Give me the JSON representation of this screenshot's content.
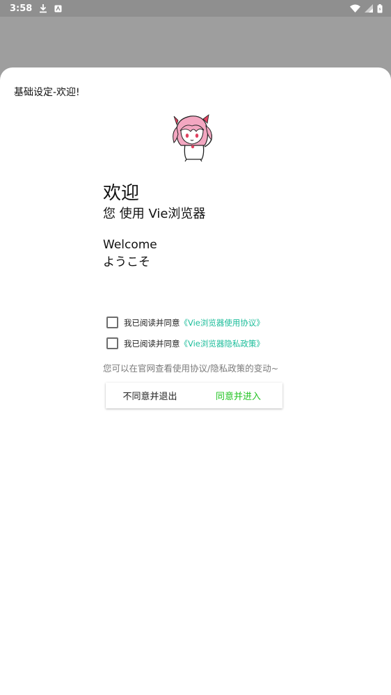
{
  "status_bar": {
    "time": "3:58",
    "icons": [
      "download-icon",
      "app-notification-icon",
      "wifi-icon",
      "signal-icon",
      "battery-icon"
    ]
  },
  "dialog": {
    "title": "基础设定-欢迎!",
    "mascot": "pink-hair-girl-mascot",
    "welcome_title": "欢迎",
    "welcome_sub": "您 使用 Vie浏览器",
    "welcome_en": "Welcome",
    "welcome_jp": "ようこそ",
    "agreements": [
      {
        "prefix": "我已阅读并同意",
        "link": "《Vie浏览器使用协议》",
        "checked": false
      },
      {
        "prefix": "我已阅读并同意",
        "link": "《Vie浏览器隐私政策》",
        "checked": false
      }
    ],
    "note": "您可以在官网查看使用协议/隐私政策的变动~",
    "buttons": {
      "disagree": "不同意并退出",
      "agree": "同意并进入"
    }
  },
  "colors": {
    "link": "#1bbd9a",
    "agree": "#22c322",
    "scrim": "#9e9e9e"
  }
}
